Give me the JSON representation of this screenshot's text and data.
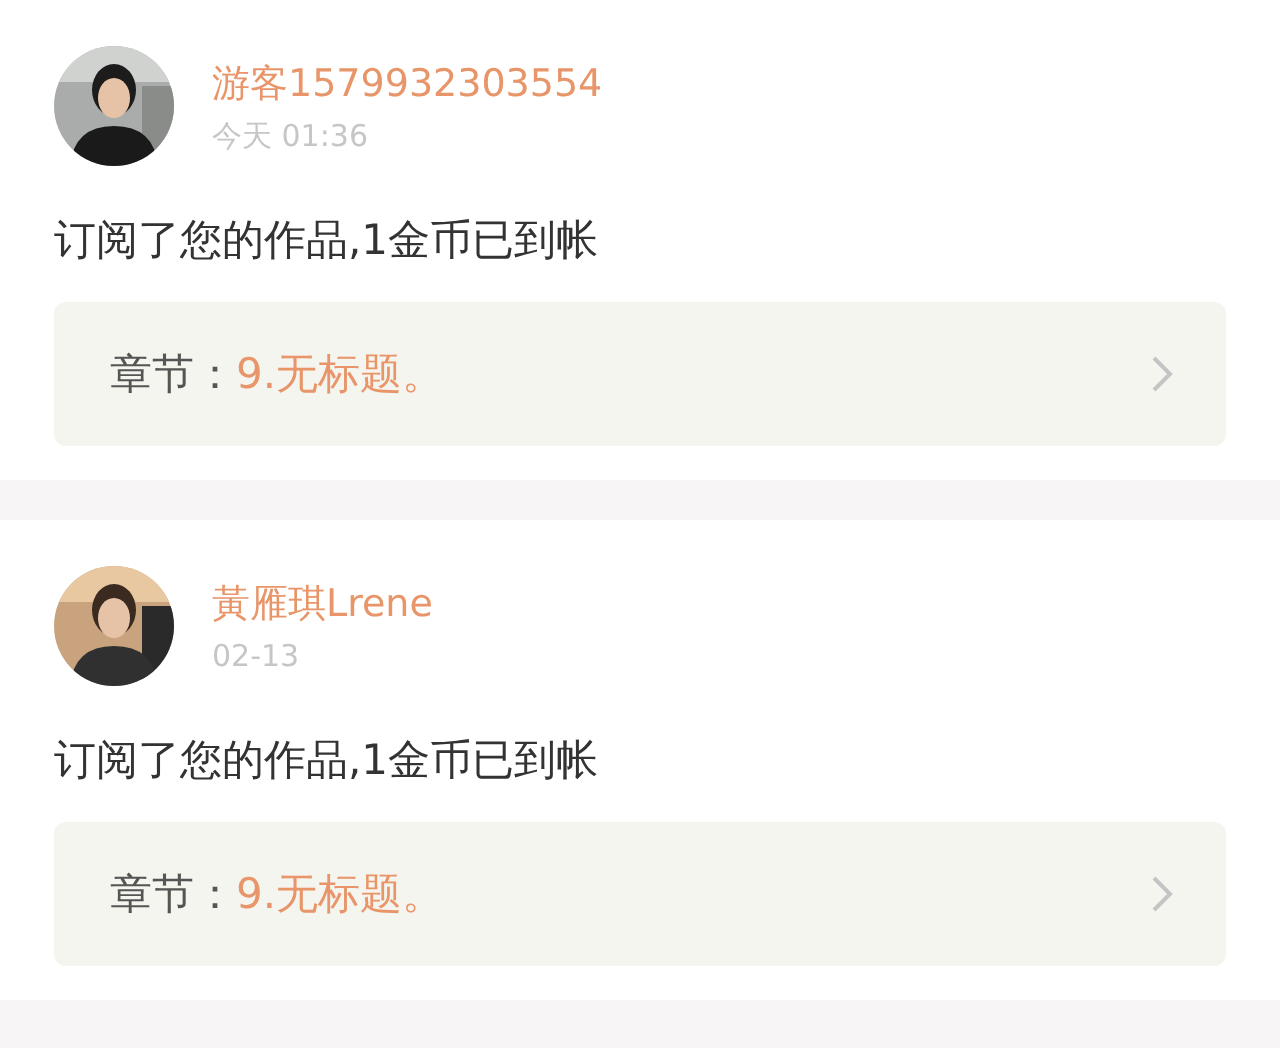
{
  "notifications": [
    {
      "user": "游客1579932303554",
      "time": "今天 01:36",
      "message": "订阅了您的作品,1金币已到帐",
      "chapter": {
        "label": "章节：",
        "title": "9.无标题。"
      }
    },
    {
      "user": "黃雁琪Lrene",
      "time": "02-13",
      "message": "订阅了您的作品,1金币已到帐",
      "chapter": {
        "label": "章节：",
        "title": "9.无标题。"
      }
    }
  ]
}
